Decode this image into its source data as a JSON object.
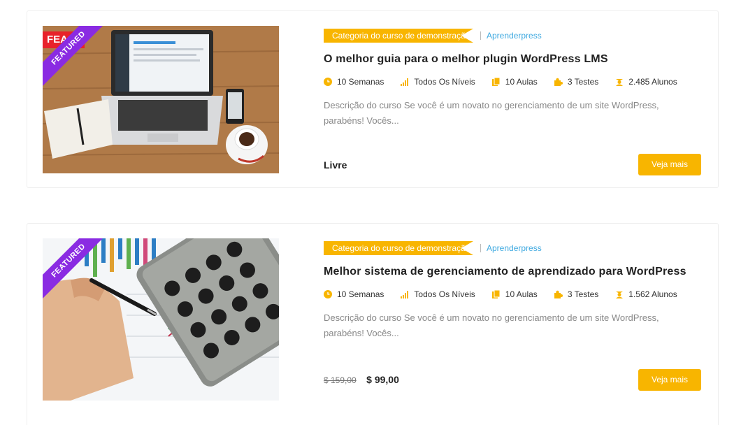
{
  "courses": [
    {
      "badge": "FEATURED",
      "sale_flag": "FEA",
      "category": "Categoria do curso de demonstração",
      "author": "Aprenderpress",
      "title": "O melhor guia para o melhor plugin WordPress LMS",
      "meta": {
        "duration": "10 Semanas",
        "level": "Todos Os Níveis",
        "lessons": "10 Aulas",
        "quizzes": "3 Testes",
        "students": "2.485 Alunos"
      },
      "description": "Descrição do curso Se você é um novato no gerenciamento de um site WordPress, parabéns! Vocês...",
      "price": "Livre",
      "button": "Veja mais"
    },
    {
      "badge": "FEATURED",
      "category": "Categoria do curso de demonstração",
      "author": "Aprenderpress",
      "title": "Melhor sistema de gerenciamento de aprendizado para WordPress",
      "meta": {
        "duration": "10 Semanas",
        "level": "Todos Os Níveis",
        "lessons": "10 Aulas",
        "quizzes": "3 Testes",
        "students": "1.562 Alunos"
      },
      "description": "Descrição do curso Se você é um novato no gerenciamento de um site WordPress, parabéns! Vocês...",
      "price_old": "$ 159,00",
      "price_new": "$ 99,00",
      "button": "Veja mais"
    }
  ],
  "colors": {
    "accent": "#f8b500",
    "link": "#3fa9e0",
    "ribbon": "#8a2be2",
    "sale": "#e8222a"
  },
  "icons": [
    "clock-icon",
    "signal-bars-icon",
    "copy-icon",
    "puzzle-icon",
    "student-icon"
  ]
}
